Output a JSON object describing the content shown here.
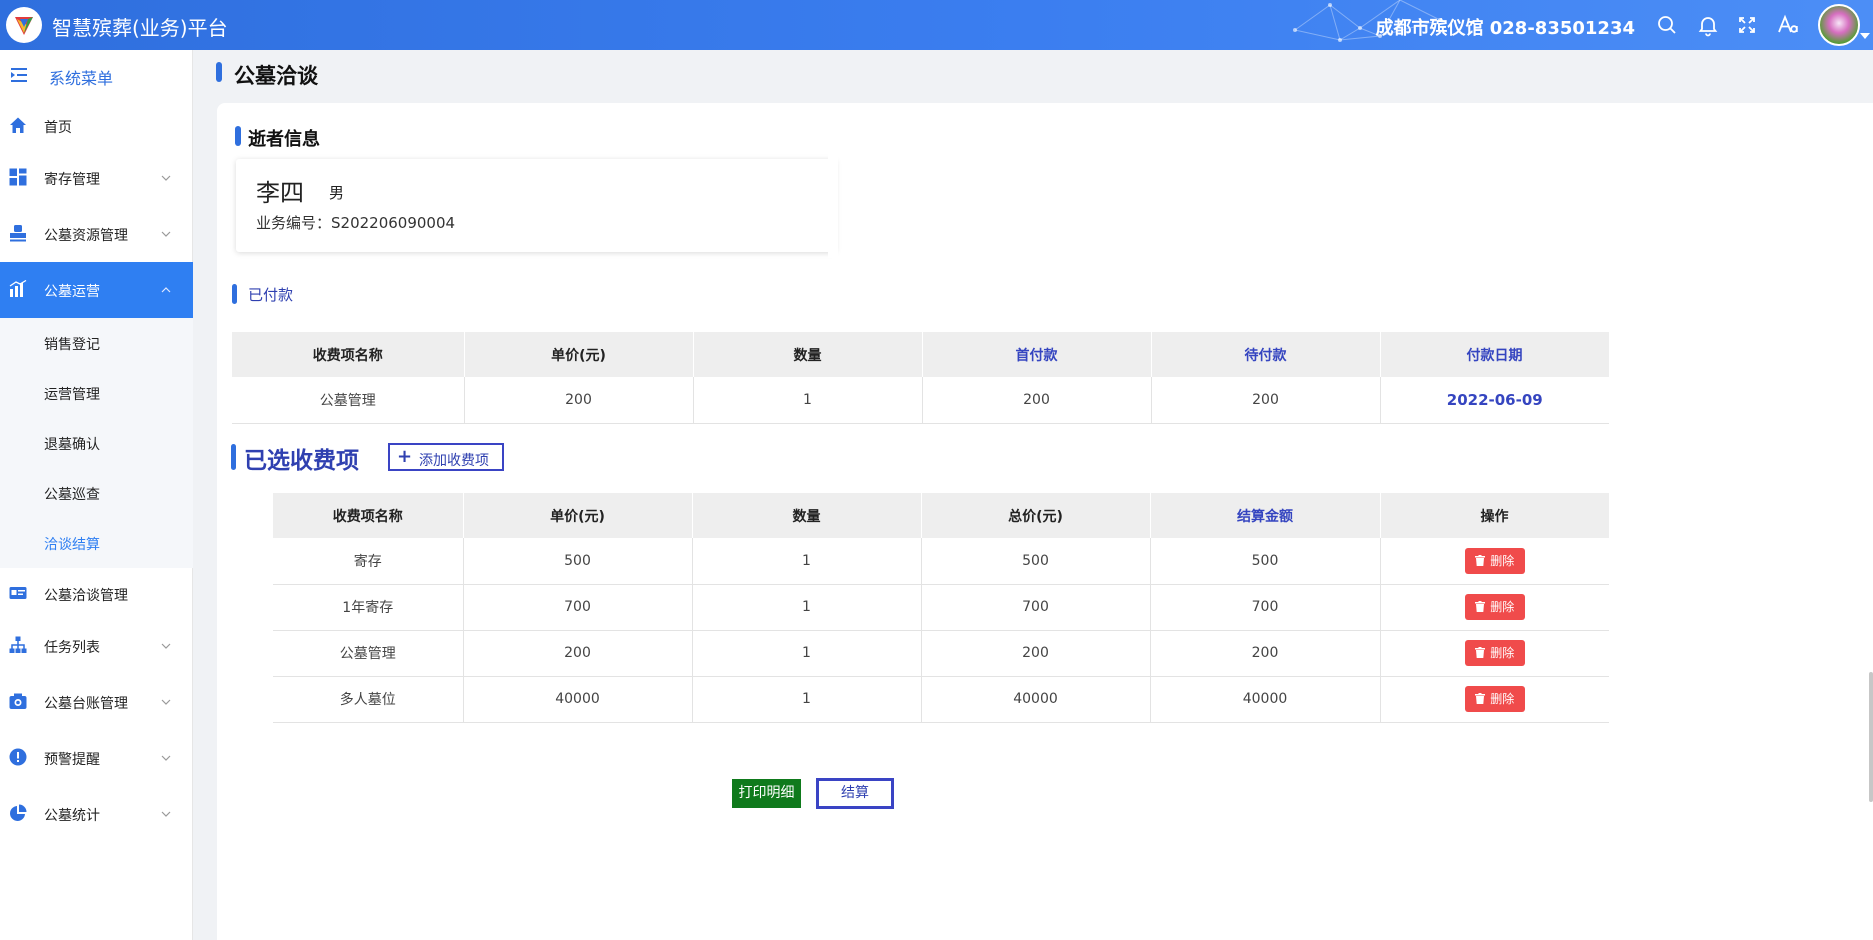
{
  "app": {
    "title": "智慧殡葬(业务)平台",
    "org": "成都市殡仪馆 028-83501234"
  },
  "colors": {
    "brand": "#2f6fde",
    "accent_text": "#2f40b0",
    "active_menu": "#2f7ff2",
    "danger": "#f04b4b",
    "print_green": "#0f7a1c"
  },
  "topbar": {
    "icons": [
      "search-icon",
      "bell-icon",
      "fullscreen-icon",
      "font-size-icon"
    ]
  },
  "sidebar": {
    "header": "系统菜单",
    "items": [
      {
        "label": "首页",
        "icon": "home-icon"
      },
      {
        "label": "寄存管理",
        "icon": "grid-icon"
      },
      {
        "label": "公墓资源管理",
        "icon": "stamp-icon"
      },
      {
        "label": "公墓运营",
        "icon": "chart-icon"
      },
      {
        "label": "公墓洽谈管理",
        "icon": "card-icon"
      },
      {
        "label": "任务列表",
        "icon": "org-tree-icon"
      },
      {
        "label": "公墓台账管理",
        "icon": "camera-icon"
      },
      {
        "label": "预警提醒",
        "icon": "alert-icon"
      },
      {
        "label": "公墓统计",
        "icon": "pie-icon"
      }
    ],
    "sub_items": [
      "销售登记",
      "运营管理",
      "退墓确认",
      "公墓巡查",
      "洽谈结算"
    ]
  },
  "page": {
    "title": "公墓洽谈"
  },
  "deceased": {
    "section_title": "逝者信息",
    "name": "李四",
    "gender": "男",
    "business_no": "业务编号：S202206090004"
  },
  "paid": {
    "title": "已付款",
    "headers": [
      "收费项名称",
      "单价(元)",
      "数量",
      "首付款",
      "待付款",
      "付款日期"
    ],
    "rows": [
      [
        "公墓管理",
        "200",
        "1",
        "200",
        "200",
        "2022-06-09"
      ]
    ]
  },
  "selected": {
    "title": "已选收费项",
    "add_button": "添加收费项",
    "headers": [
      "收费项名称",
      "单价(元)",
      "数量",
      "总价(元)",
      "结算金额",
      "操作"
    ],
    "delete_label": "删除",
    "rows": [
      [
        "寄存",
        "500",
        "1",
        "500",
        "500"
      ],
      [
        "1年寄存",
        "700",
        "1",
        "700",
        "700"
      ],
      [
        "公墓管理",
        "200",
        "1",
        "200",
        "200"
      ],
      [
        "多人墓位",
        "40000",
        "1",
        "40000",
        "40000"
      ]
    ]
  },
  "actions": {
    "print": "打印明细",
    "settle": "结算"
  }
}
